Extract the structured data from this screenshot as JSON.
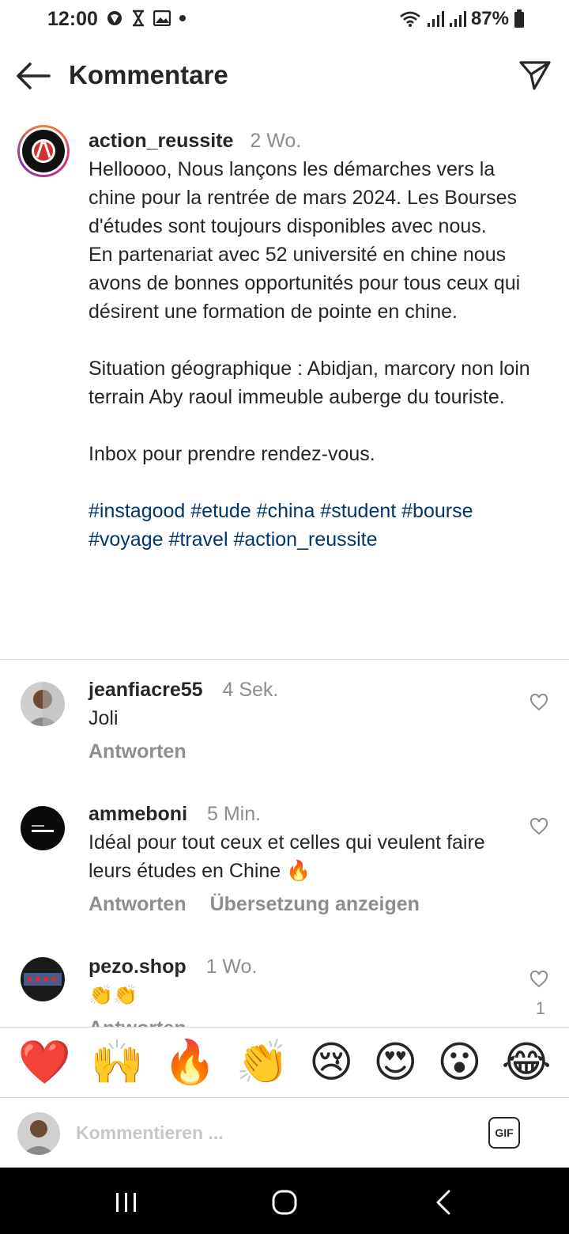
{
  "status_bar": {
    "time": "12:00",
    "battery": "87%"
  },
  "header": {
    "title": "Kommentare"
  },
  "caption": {
    "username": "action_reussite",
    "time": "2 Wo.",
    "text": "Helloooo, Nous lançons les démarches vers la chine pour la rentrée de mars 2024. Les Bourses d'études sont toujours disponibles avec nous.\nEn partenariat avec 52 université en chine nous avons de bonnes opportunités pour tous ceux qui désirent une formation de pointe en chine.\n\nSituation géographique : Abidjan, marcory non loin terrain Aby raoul immeuble auberge du touriste.\n\nInbox pour prendre rendez-vous.\n\n",
    "hashtags": "#instagood #etude #china #student #bourse #voyage #travel #action_reussite"
  },
  "comments": [
    {
      "username": "jeanfiacre55",
      "time": "4 Sek.",
      "text": "Joli",
      "reply": "Antworten"
    },
    {
      "username": "ammeboni",
      "time": "5 Min.",
      "text": "Idéal pour tout ceux et celles qui veulent faire leurs études en Chine 🔥",
      "reply": "Antworten",
      "translate": "Übersetzung anzeigen"
    },
    {
      "username": "pezo.shop",
      "time": "1 Wo.",
      "text": "👏👏",
      "reply": "Antworten",
      "likes": "1"
    }
  ],
  "emoji_bar": [
    "❤️",
    "🙌",
    "🔥",
    "👏",
    "😢",
    "😍",
    "😮",
    "😂"
  ],
  "input": {
    "placeholder": "Kommentieren ...",
    "gif_label": "GIF"
  },
  "colors": {
    "hashtag": "#00376b",
    "muted": "#8e8e8e",
    "text": "#262626"
  }
}
